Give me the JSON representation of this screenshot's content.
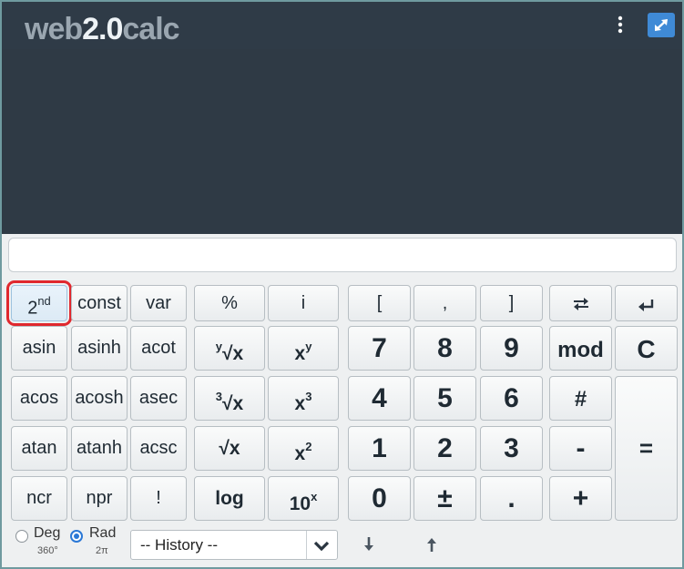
{
  "logo": {
    "part1": "web",
    "part2": "2.0",
    "part3": "calc"
  },
  "header": {
    "menu_icon": "vertical-dots",
    "expand_icon": "expand-arrows"
  },
  "input": {
    "value": ""
  },
  "keys": {
    "second": {
      "base": "2",
      "sup": "nd"
    },
    "const": "const",
    "var": "var",
    "percent": "%",
    "imag": "i",
    "lbracket": "[",
    "comma": ",",
    "rbracket": "]",
    "swap_icon": "swap-arrows",
    "backspace_icon": "backspace-arrow",
    "asin": "asin",
    "asinh": "asinh",
    "acot": "acot",
    "yroot": {
      "sup": "y",
      "body": "√x"
    },
    "xpowy": {
      "base": "x",
      "sup": "y"
    },
    "seven": "7",
    "eight": "8",
    "nine": "9",
    "mod": "mod",
    "clear": "C",
    "acos": "acos",
    "acosh": "acosh",
    "asec": "asec",
    "cuberoot": {
      "sup": "3",
      "body": "√x"
    },
    "cube": {
      "base": "x",
      "sup": "3"
    },
    "four": "4",
    "five": "5",
    "six": "6",
    "hash": "#",
    "atan": "atan",
    "atanh": "atanh",
    "acsc": "acsc",
    "sqrt": "√x",
    "square": {
      "base": "x",
      "sup": "2"
    },
    "one": "1",
    "two": "2",
    "three": "3",
    "minus": "-",
    "equals": "=",
    "ncr": "ncr",
    "npr": "npr",
    "fact": "!",
    "log": "log",
    "tenpow": {
      "base": "10",
      "sup": "x"
    },
    "zero": "0",
    "plusminus": "±",
    "dot": ".",
    "plus": "+"
  },
  "angle": {
    "deg_label": "Deg",
    "deg_sub": "360°",
    "rad_label": "Rad",
    "rad_sub": "2π",
    "selected": "Rad"
  },
  "history": {
    "placeholder": "-- History --",
    "down_icon": "arrow-down",
    "up_icon": "arrow-up"
  },
  "colors": {
    "header": "#2f3b47",
    "display": "#2f3a45",
    "highlight": "#e0282e",
    "accent": "#3f8ad6"
  }
}
